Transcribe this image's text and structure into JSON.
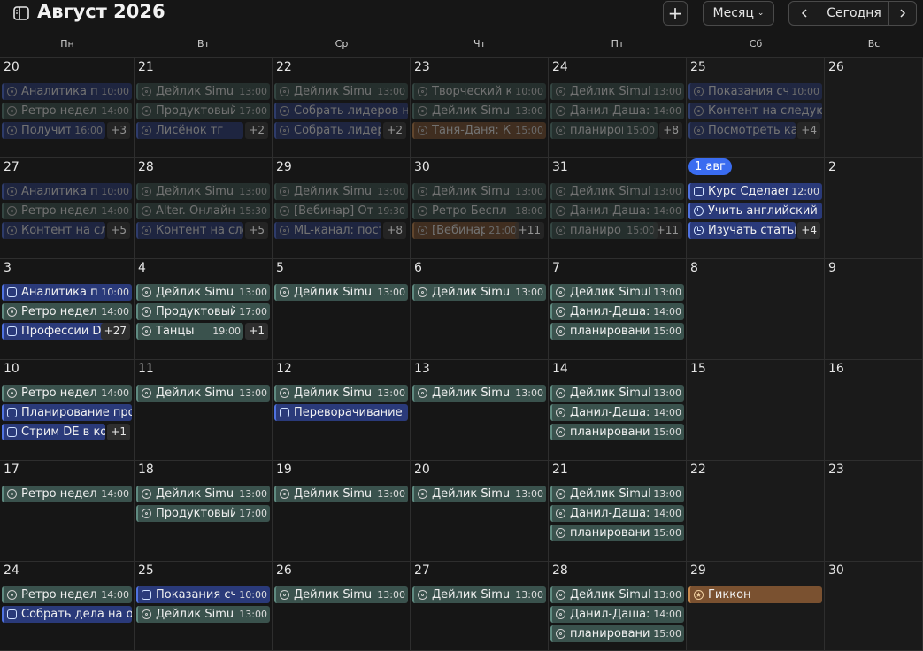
{
  "header": {
    "title": "Август 2026",
    "add_label": "+",
    "view_label": "Месяц",
    "today_label": "Сегодня"
  },
  "weekdays": [
    "Пн",
    "Вт",
    "Ср",
    "Чт",
    "Пт",
    "Сб",
    "Вс"
  ],
  "weeks": [
    [
      {
        "label": "20",
        "events": [
          {
            "title": "Аналитика по",
            "time": "10:00",
            "color": "blue",
            "icon": "circle"
          },
          {
            "title": "Ретро недели",
            "time": "14:00",
            "color": "teal",
            "icon": "circle"
          },
          {
            "title": "Получить",
            "time": "16:00",
            "color": "blue",
            "icon": "circle"
          }
        ],
        "more": "+3",
        "past": true
      },
      {
        "label": "21",
        "events": [
          {
            "title": "Дейлик Simul",
            "time": "13:00",
            "color": "teal",
            "icon": "circle"
          },
          {
            "title": "Продуктовый",
            "time": "17:00",
            "color": "teal",
            "icon": "circle"
          },
          {
            "title": "Лисёнок тг",
            "time": "",
            "color": "blue",
            "icon": "circle"
          }
        ],
        "more": "+2",
        "past": true
      },
      {
        "label": "22",
        "events": [
          {
            "title": "Дейлик Simul",
            "time": "13:00",
            "color": "teal",
            "icon": "circle"
          },
          {
            "title": "Собрать лидеров на",
            "time": "",
            "color": "blue",
            "icon": "circle"
          },
          {
            "title": "Собрать лидер",
            "time": "",
            "color": "blue",
            "icon": "circle"
          }
        ],
        "more": "+2",
        "past": true
      },
      {
        "label": "23",
        "events": [
          {
            "title": "Творческий к",
            "time": "10:00",
            "color": "teal",
            "icon": "circle"
          },
          {
            "title": "Дейлик Simul",
            "time": "13:00",
            "color": "teal",
            "icon": "circle"
          },
          {
            "title": "Таня-Даня: КГ",
            "time": "15:00",
            "color": "orange",
            "icon": "circle"
          }
        ],
        "more": "",
        "past": true
      },
      {
        "label": "24",
        "events": [
          {
            "title": "Дейлик Simul",
            "time": "13:00",
            "color": "teal",
            "icon": "circle"
          },
          {
            "title": "Данил-Даша:",
            "time": "14:00",
            "color": "teal",
            "icon": "circle"
          },
          {
            "title": "планиров",
            "time": "15:00",
            "color": "teal",
            "icon": "circle"
          }
        ],
        "more": "+8",
        "past": true
      },
      {
        "label": "25",
        "events": [
          {
            "title": "Показания сч",
            "time": "10:00",
            "color": "blue",
            "icon": "circle"
          },
          {
            "title": "Контент на следующ",
            "time": "",
            "color": "blue",
            "icon": "circle"
          },
          {
            "title": "Посмотреть ка",
            "time": "",
            "color": "blue",
            "icon": "circle"
          }
        ],
        "more": "+4",
        "past": true
      },
      {
        "label": "26",
        "events": [],
        "more": "",
        "past": true
      }
    ],
    [
      {
        "label": "27",
        "events": [
          {
            "title": "Аналитика по",
            "time": "10:00",
            "color": "blue",
            "icon": "circle"
          },
          {
            "title": "Ретро недели",
            "time": "14:00",
            "color": "teal",
            "icon": "circle"
          },
          {
            "title": "Контент на сле",
            "time": "",
            "color": "blue",
            "icon": "circle"
          }
        ],
        "more": "+5",
        "past": true
      },
      {
        "label": "28",
        "events": [
          {
            "title": "Дейлик Simul",
            "time": "13:00",
            "color": "teal",
            "icon": "circle"
          },
          {
            "title": "Alter. Онлайн",
            "time": "15:30",
            "color": "teal",
            "icon": "circle"
          },
          {
            "title": "Контент на сле",
            "time": "",
            "color": "blue",
            "icon": "circle"
          }
        ],
        "more": "+5",
        "past": true
      },
      {
        "label": "29",
        "events": [
          {
            "title": "Дейлик Simul",
            "time": "13:00",
            "color": "teal",
            "icon": "circle"
          },
          {
            "title": "[Вебинар] От",
            "time": "19:30",
            "color": "teal",
            "icon": "circle"
          },
          {
            "title": "ML-канал: пост",
            "time": "",
            "color": "blue",
            "icon": "circle"
          }
        ],
        "more": "+8",
        "past": true
      },
      {
        "label": "30",
        "events": [
          {
            "title": "Дейлик Simul",
            "time": "13:00",
            "color": "teal",
            "icon": "circle"
          },
          {
            "title": "Ретро Беспл S",
            "time": "18:00",
            "color": "teal",
            "icon": "circle"
          },
          {
            "title": "[Вебинар",
            "time": "21:00",
            "color": "orange",
            "icon": "circle"
          }
        ],
        "more": "+11",
        "past": true
      },
      {
        "label": "31",
        "events": [
          {
            "title": "Дейлик Simul",
            "time": "13:00",
            "color": "teal",
            "icon": "circle"
          },
          {
            "title": "Данил-Даша:",
            "time": "14:00",
            "color": "teal",
            "icon": "circle"
          },
          {
            "title": "планиро",
            "time": "15:00",
            "color": "teal",
            "icon": "circle"
          }
        ],
        "more": "+11",
        "past": true
      },
      {
        "label": "1 авг",
        "today": true,
        "events": [
          {
            "title": "Курс Сделаем",
            "time": "12:00",
            "color": "blue",
            "icon": "square"
          },
          {
            "title": "Учить английский",
            "time": "",
            "color": "blue",
            "icon": "clock"
          },
          {
            "title": "Изучать статьи",
            "time": "",
            "color": "blue",
            "icon": "clock"
          }
        ],
        "more": "+4",
        "past": false
      },
      {
        "label": "2",
        "events": [],
        "more": "",
        "past": false
      }
    ],
    [
      {
        "label": "3",
        "events": [
          {
            "title": "Аналитика по",
            "time": "10:00",
            "color": "blue",
            "icon": "square"
          },
          {
            "title": "Ретро недели",
            "time": "14:00",
            "color": "teal",
            "icon": "circle"
          },
          {
            "title": "Профессии D",
            "time": "",
            "color": "blue",
            "icon": "square"
          }
        ],
        "more": "+27",
        "past": false
      },
      {
        "label": "4",
        "events": [
          {
            "title": "Дейлик Simul",
            "time": "13:00",
            "color": "teal",
            "icon": "circle"
          },
          {
            "title": "Продуктовый",
            "time": "17:00",
            "color": "teal",
            "icon": "circle"
          },
          {
            "title": "Танцы",
            "time": "19:00",
            "color": "teal",
            "icon": "circle"
          }
        ],
        "more": "+1",
        "past": false
      },
      {
        "label": "5",
        "events": [
          {
            "title": "Дейлик Simul",
            "time": "13:00",
            "color": "teal",
            "icon": "circle"
          }
        ],
        "more": "",
        "past": false
      },
      {
        "label": "6",
        "events": [
          {
            "title": "Дейлик Simul",
            "time": "13:00",
            "color": "teal",
            "icon": "circle"
          }
        ],
        "more": "",
        "past": false
      },
      {
        "label": "7",
        "events": [
          {
            "title": "Дейлик Simul",
            "time": "13:00",
            "color": "teal",
            "icon": "circle"
          },
          {
            "title": "Данил-Даша:",
            "time": "14:00",
            "color": "teal",
            "icon": "circle"
          },
          {
            "title": "планировани",
            "time": "15:00",
            "color": "teal",
            "icon": "circle"
          }
        ],
        "more": "",
        "past": false
      },
      {
        "label": "8",
        "events": [],
        "more": "",
        "past": false
      },
      {
        "label": "9",
        "events": [],
        "more": "",
        "past": false
      }
    ],
    [
      {
        "label": "10",
        "events": [
          {
            "title": "Ретро недели",
            "time": "14:00",
            "color": "teal",
            "icon": "circle"
          },
          {
            "title": "Планирование про",
            "time": "",
            "color": "blue",
            "icon": "square"
          },
          {
            "title": "Стрим DE в ко",
            "time": "",
            "color": "blue",
            "icon": "square"
          }
        ],
        "more": "+1",
        "past": false
      },
      {
        "label": "11",
        "events": [
          {
            "title": "Дейлик Simul",
            "time": "13:00",
            "color": "teal",
            "icon": "circle"
          }
        ],
        "more": "",
        "past": false
      },
      {
        "label": "12",
        "events": [
          {
            "title": "Дейлик Simul",
            "time": "13:00",
            "color": "teal",
            "icon": "circle"
          },
          {
            "title": "Переворачивание",
            "time": "",
            "color": "blue",
            "icon": "square"
          }
        ],
        "more": "",
        "past": false
      },
      {
        "label": "13",
        "events": [
          {
            "title": "Дейлик Simul",
            "time": "13:00",
            "color": "teal",
            "icon": "circle"
          }
        ],
        "more": "",
        "past": false
      },
      {
        "label": "14",
        "events": [
          {
            "title": "Дейлик Simul",
            "time": "13:00",
            "color": "teal",
            "icon": "circle"
          },
          {
            "title": "Данил-Даша:",
            "time": "14:00",
            "color": "teal",
            "icon": "circle"
          },
          {
            "title": "планировани",
            "time": "15:00",
            "color": "teal",
            "icon": "circle"
          }
        ],
        "more": "",
        "past": false
      },
      {
        "label": "15",
        "events": [],
        "more": "",
        "past": false
      },
      {
        "label": "16",
        "events": [],
        "more": "",
        "past": false
      }
    ],
    [
      {
        "label": "17",
        "events": [
          {
            "title": "Ретро недели",
            "time": "14:00",
            "color": "teal",
            "icon": "circle"
          }
        ],
        "more": "",
        "past": false
      },
      {
        "label": "18",
        "events": [
          {
            "title": "Дейлик Simul",
            "time": "13:00",
            "color": "teal",
            "icon": "circle"
          },
          {
            "title": "Продуктовый",
            "time": "17:00",
            "color": "teal",
            "icon": "circle"
          }
        ],
        "more": "",
        "past": false
      },
      {
        "label": "19",
        "events": [
          {
            "title": "Дейлик Simul",
            "time": "13:00",
            "color": "teal",
            "icon": "circle"
          }
        ],
        "more": "",
        "past": false
      },
      {
        "label": "20",
        "events": [
          {
            "title": "Дейлик Simul",
            "time": "13:00",
            "color": "teal",
            "icon": "circle"
          }
        ],
        "more": "",
        "past": false
      },
      {
        "label": "21",
        "events": [
          {
            "title": "Дейлик Simul",
            "time": "13:00",
            "color": "teal",
            "icon": "circle"
          },
          {
            "title": "Данил-Даша:",
            "time": "14:00",
            "color": "teal",
            "icon": "circle"
          },
          {
            "title": "планировани",
            "time": "15:00",
            "color": "teal",
            "icon": "circle"
          }
        ],
        "more": "",
        "past": false
      },
      {
        "label": "22",
        "events": [],
        "more": "",
        "past": false
      },
      {
        "label": "23",
        "events": [],
        "more": "",
        "past": false
      }
    ],
    [
      {
        "label": "24",
        "events": [
          {
            "title": "Ретро недели",
            "time": "14:00",
            "color": "teal",
            "icon": "circle"
          },
          {
            "title": "Собрать дела на о",
            "time": "",
            "color": "blue",
            "icon": "square"
          }
        ],
        "more": "",
        "past": false
      },
      {
        "label": "25",
        "events": [
          {
            "title": "Показания сч",
            "time": "10:00",
            "color": "blue",
            "icon": "square"
          },
          {
            "title": "Дейлик Simul",
            "time": "13:00",
            "color": "teal",
            "icon": "circle"
          }
        ],
        "more": "",
        "past": false
      },
      {
        "label": "26",
        "events": [
          {
            "title": "Дейлик Simul",
            "time": "13:00",
            "color": "teal",
            "icon": "circle"
          }
        ],
        "more": "",
        "past": false
      },
      {
        "label": "27",
        "events": [
          {
            "title": "Дейлик Simul",
            "time": "13:00",
            "color": "teal",
            "icon": "circle"
          }
        ],
        "more": "",
        "past": false
      },
      {
        "label": "28",
        "events": [
          {
            "title": "Дейлик Simul",
            "time": "13:00",
            "color": "teal",
            "icon": "circle"
          },
          {
            "title": "Данил-Даша:",
            "time": "14:00",
            "color": "teal",
            "icon": "circle"
          },
          {
            "title": "планировани",
            "time": "15:00",
            "color": "teal",
            "icon": "circle"
          }
        ],
        "more": "",
        "past": false
      },
      {
        "label": "29",
        "events": [
          {
            "title": "Гиккон",
            "time": "",
            "color": "orange",
            "icon": "star"
          }
        ],
        "more": "",
        "past": false
      },
      {
        "label": "30",
        "events": [],
        "more": "",
        "past": false
      }
    ]
  ]
}
